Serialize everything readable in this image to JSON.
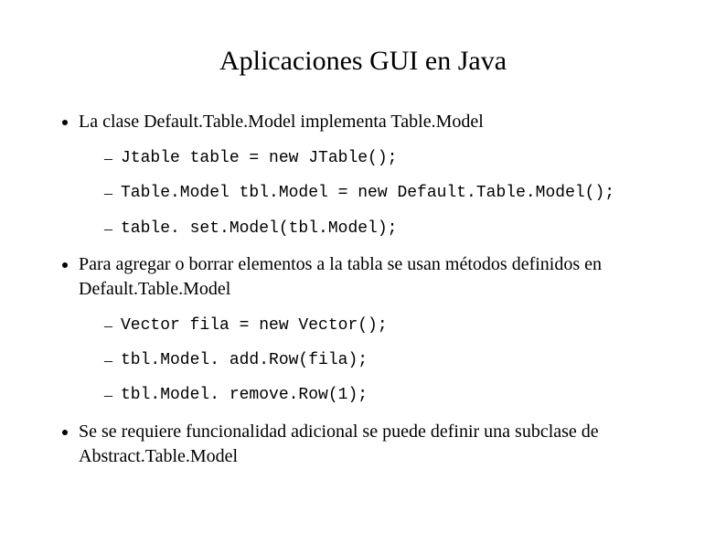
{
  "title": "Aplicaciones GUI en Java",
  "bullets": [
    {
      "lead": "La clase Default.Table.Model implementa Table.Model",
      "code": [
        "Jtable table = new JTable();",
        "Table.Model tbl.Model = new Default.Table.Model();",
        "table. set.Model(tbl.Model);"
      ]
    },
    {
      "lead": "Para agregar o borrar elementos a la tabla se usan métodos definidos en Default.Table.Model",
      "code": [
        "Vector fila = new Vector();",
        "tbl.Model. add.Row(fila);",
        "tbl.Model. remove.Row(1);"
      ]
    },
    {
      "lead": "Se se requiere funcionalidad adicional se puede definir una subclase de Abstract.Table.Model",
      "code": []
    }
  ]
}
